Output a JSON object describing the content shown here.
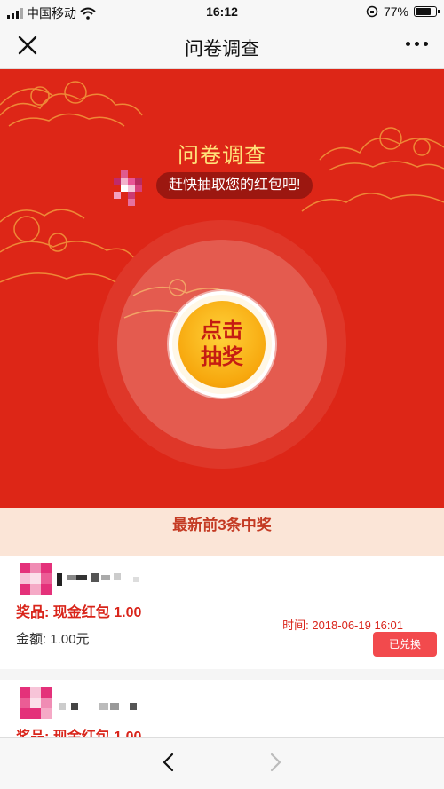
{
  "status_bar": {
    "carrier": "中国移动",
    "time": "16:12",
    "battery": "77%",
    "battery_level": 0.77
  },
  "nav": {
    "title": "问卷调查",
    "close_icon": "close-icon",
    "more_icon": "more-icon"
  },
  "banner": {
    "headline": "问卷调查",
    "bubble_text": "赶快抽取您的红包吧!",
    "draw_button_label": "点击抽奖",
    "colors": {
      "background": "#dd2617",
      "headline": "#ffe27a",
      "coin": "#f7a70d"
    }
  },
  "winners": {
    "header": "最新前3条中奖",
    "entries": [
      {
        "prize_label": "奖品:",
        "prize_name": "现金红包 1.00",
        "amount_label": "金额:",
        "amount": "1.00元",
        "time_label": "时间:",
        "time": "2018-06-19 16:01",
        "status_button": "已兑换"
      },
      {
        "prize_label": "奖品:",
        "prize_name": "现金红包 1.00"
      }
    ]
  },
  "bottom_bar": {
    "back_icon": "chevron-left-icon",
    "forward_icon": "chevron-right-icon"
  }
}
